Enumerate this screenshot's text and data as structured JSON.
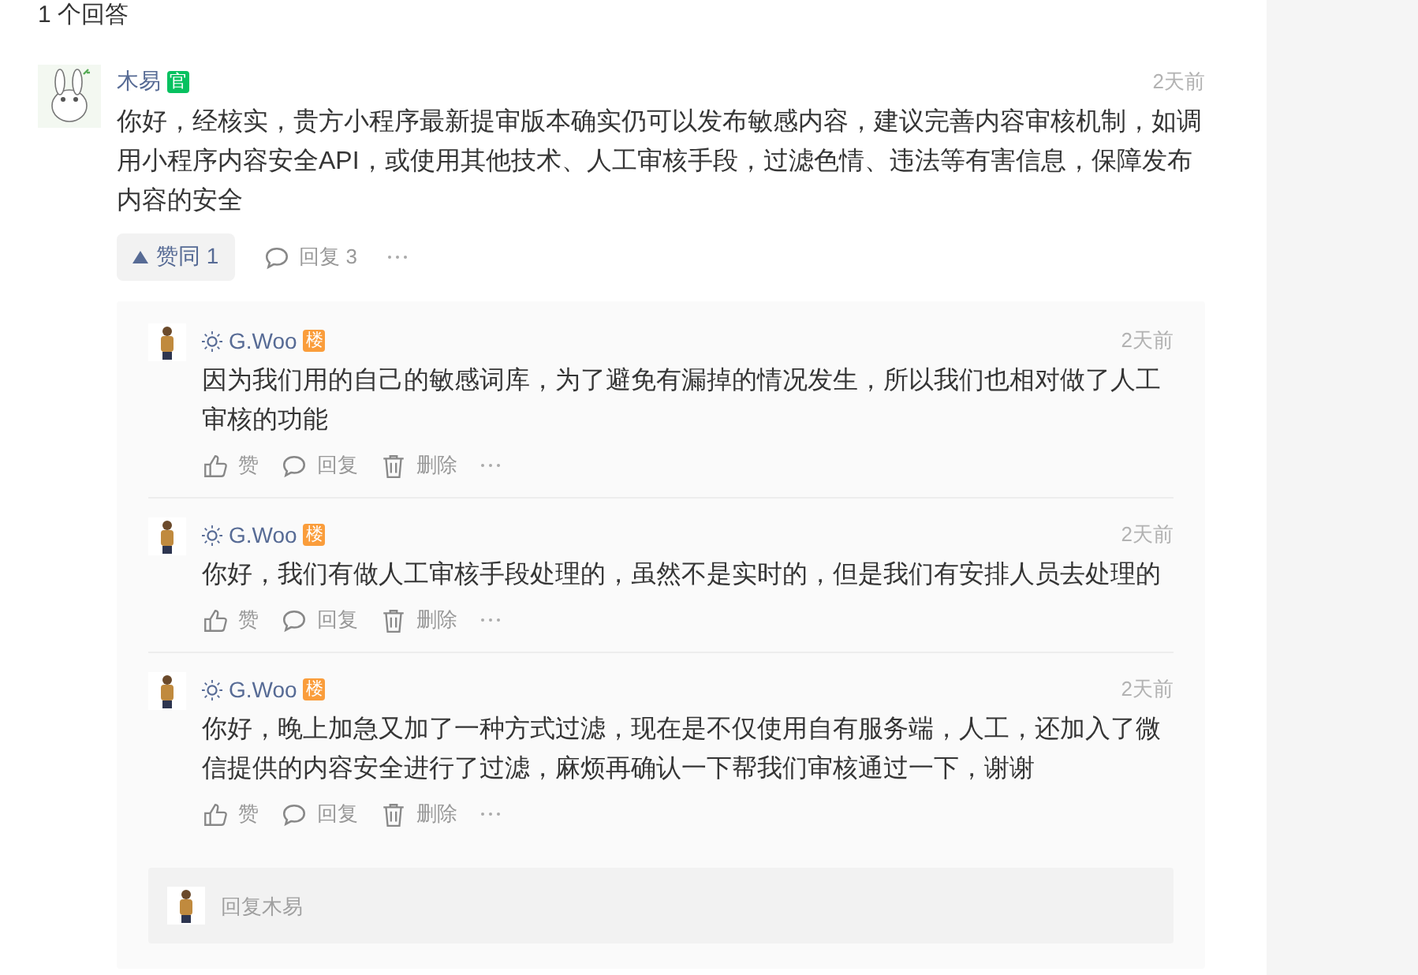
{
  "heading": "1 个回答",
  "answer": {
    "author": "木易",
    "badge": {
      "text": "官",
      "color": "#07c160"
    },
    "time": "2天前",
    "text": "你好，经核实，贵方小程序最新提审版本确实仍可以发布敏感内容，建议完善内容审核机制，如调用小程序内容安全API，或使用其他技术、人工审核手段，过滤色情、违法等有害信息，保障发布内容的安全",
    "upvote": {
      "label": "赞同 1"
    },
    "reply_count": "回复 3"
  },
  "replies": [
    {
      "author": "G.Woo",
      "badge": {
        "text": "楼",
        "color": "#fa9d3b"
      },
      "time": "2天前",
      "text": "因为我们用的自己的敏感词库，为了避免有漏掉的情况发生，所以我们也相对做了人工审核的功能",
      "actions": [
        "赞",
        "回复",
        "删除"
      ]
    },
    {
      "author": "G.Woo",
      "badge": {
        "text": "楼",
        "color": "#fa9d3b"
      },
      "time": "2天前",
      "text": "你好，我们有做人工审核手段处理的，虽然不是实时的，但是我们有安排人员去处理的",
      "actions": [
        "赞",
        "回复",
        "删除"
      ]
    },
    {
      "author": "G.Woo",
      "badge": {
        "text": "楼",
        "color": "#fa9d3b"
      },
      "time": "2天前",
      "text": "你好，晚上加急又加了一种方式过滤，现在是不仅使用自有服务端，人工，还加入了微信提供的内容安全进行了过滤，麻烦再确认一下帮我们审核通过一下，谢谢",
      "actions": [
        "赞",
        "回复",
        "删除"
      ]
    }
  ],
  "reply_box": {
    "placeholder": "回复木易"
  }
}
